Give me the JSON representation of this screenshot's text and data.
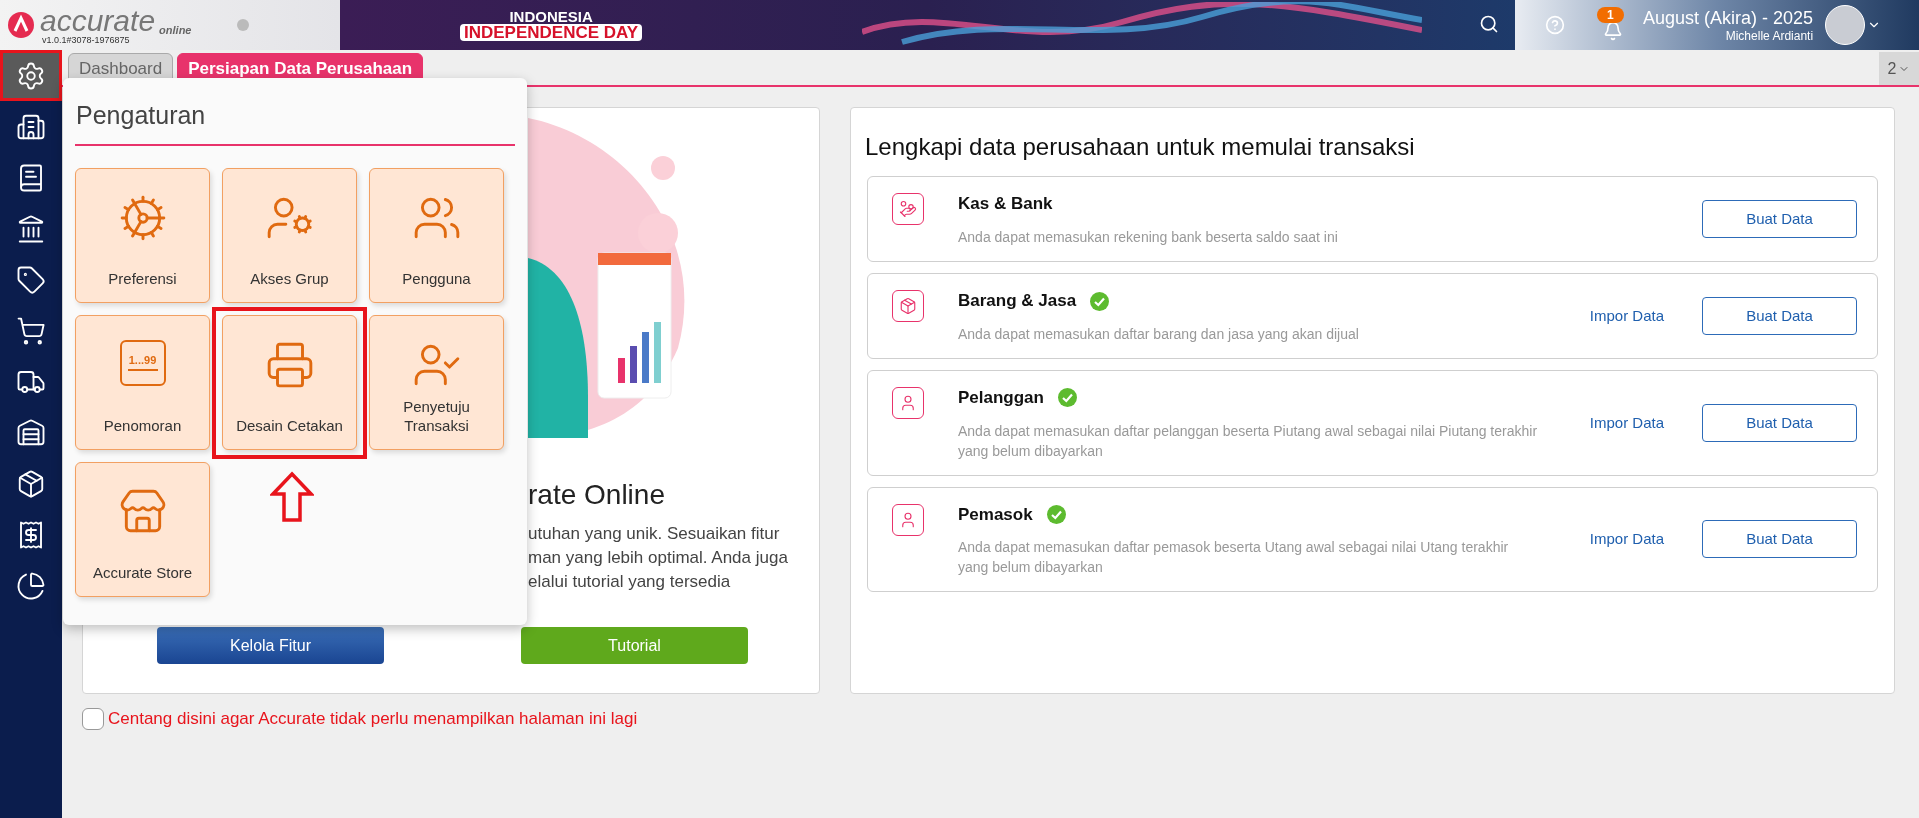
{
  "header": {
    "logo": "accurate",
    "logo_sub": "online",
    "version": "v1.0.1#3078-1976875",
    "banner": [
      "INDONESIA",
      "INDEPENDENCE DAY"
    ],
    "notifications": "1",
    "period": "August (Akira) - 2025",
    "user": "Michelle Ardianti"
  },
  "sidebar": {
    "items": [
      {
        "kind": "settings",
        "selected": true,
        "highlighted": true
      },
      {
        "kind": "company",
        "selected": false,
        "highlighted": false
      },
      {
        "kind": "book",
        "selected": false,
        "highlighted": false
      },
      {
        "kind": "bank",
        "selected": false,
        "highlighted": false
      },
      {
        "kind": "price-tag",
        "selected": false,
        "highlighted": false
      },
      {
        "kind": "cart",
        "selected": false,
        "highlighted": false
      },
      {
        "kind": "trolley",
        "selected": false,
        "highlighted": false
      },
      {
        "kind": "warehouse",
        "selected": false,
        "highlighted": false
      },
      {
        "kind": "conveyor",
        "selected": false,
        "highlighted": false
      },
      {
        "kind": "tax",
        "selected": false,
        "highlighted": false
      },
      {
        "kind": "report",
        "selected": false,
        "highlighted": false
      }
    ]
  },
  "tabs": [
    {
      "label": "Dashboard",
      "selected": false
    },
    {
      "label": "Persiapan Data Perusahaan",
      "selected": true
    }
  ],
  "tab_count": "2",
  "settings_menu": {
    "title": "Pengaturan",
    "items": [
      {
        "label": "Preferensi",
        "kind": "gears",
        "highlighted": false
      },
      {
        "label": "Akses Grup",
        "kind": "user-key",
        "highlighted": false
      },
      {
        "label": "Pengguna",
        "kind": "users",
        "highlighted": false
      },
      {
        "label": "Penomoran",
        "kind": "numbering",
        "icon_text": "1...99",
        "highlighted": false
      },
      {
        "label": "Desain Cetakan",
        "kind": "printer",
        "highlighted": true
      },
      {
        "label": "Penyetuju Transaksi",
        "kind": "user-check",
        "highlighted": false
      },
      {
        "label": "Accurate Store",
        "kind": "store",
        "highlighted": false
      }
    ]
  },
  "intro_card": {
    "heading": "rate Online",
    "lines": [
      "utuhan yang unik. Sesuaikan fitur",
      "man yang lebih optimal. Anda juga",
      "elalui tutorial yang tersedia"
    ],
    "buttons": [
      {
        "label": "Kelola Fitur",
        "kind": "primary"
      },
      {
        "label": "Tutorial",
        "kind": "success"
      }
    ]
  },
  "setup_card": {
    "title": "Lengkapi data perusahaan untuk memulai transaksi",
    "items": [
      {
        "kind": "money",
        "title": "Kas & Bank",
        "description": "Anda dapat memasukan rekening bank beserta saldo saat ini",
        "done": false,
        "button": "Buat Data"
      },
      {
        "kind": "box",
        "title": "Barang & Jasa",
        "description": "Anda dapat memasukan daftar barang dan jasa yang akan dijual",
        "done": true,
        "import": "Impor Data",
        "button": "Buat Data"
      },
      {
        "kind": "person",
        "title": "Pelanggan",
        "description": "Anda dapat memasukan daftar pelanggan beserta Piutang awal sebagai nilai Piutang terakhir yang belum dibayarkan",
        "done": true,
        "import": "Impor Data",
        "button": "Buat Data"
      },
      {
        "kind": "person",
        "title": "Pemasok",
        "description": "Anda dapat memasukan daftar pemasok beserta Utang awal sebagai nilai Utang terakhir yang belum dibayarkan",
        "done": true,
        "import": "Impor Data",
        "button": "Buat Data"
      }
    ]
  },
  "dont_show": {
    "label": "Centang disini agar Accurate tidak perlu menampilkan halaman ini lagi",
    "checked": false
  }
}
